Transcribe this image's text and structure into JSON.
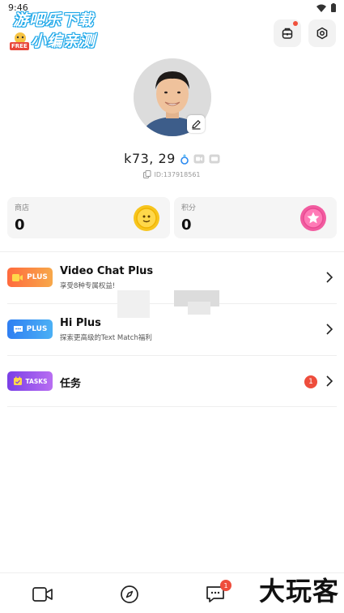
{
  "status": {
    "time": "9:46"
  },
  "watermark": {
    "line1": "游吧乐下载",
    "line2": "小编亲测",
    "badge": "FREE",
    "bottom_right": "大玩客"
  },
  "header": {
    "bag_icon": "backpack-icon",
    "settings_icon": "hexagon-settings-icon"
  },
  "profile": {
    "name": "k73, 29",
    "id": "ID:137918561"
  },
  "stats": [
    {
      "label": "商店",
      "value": "0",
      "icon": "coin-icon",
      "color": "#f5c21b"
    },
    {
      "label": "积分",
      "value": "0",
      "icon": "star-icon",
      "color": "#f0559a"
    }
  ],
  "menu": [
    {
      "badge_text": "PLUS",
      "title": "Video Chat Plus",
      "subtitle": "享受8种专属权益!",
      "badge_color": "#f5823a"
    },
    {
      "badge_text": "PLUS",
      "title": "Hi Plus",
      "subtitle": "探索更高级的Text Match福利",
      "badge_color": "#2b8af0"
    },
    {
      "badge_text": "TASKS",
      "title": "任务",
      "subtitle": "",
      "count": "1",
      "badge_color": "#8a4ee8"
    }
  ],
  "tabs": [
    {
      "icon": "video-camera-icon"
    },
    {
      "icon": "compass-icon"
    },
    {
      "icon": "chat-icon",
      "count": "1"
    }
  ]
}
